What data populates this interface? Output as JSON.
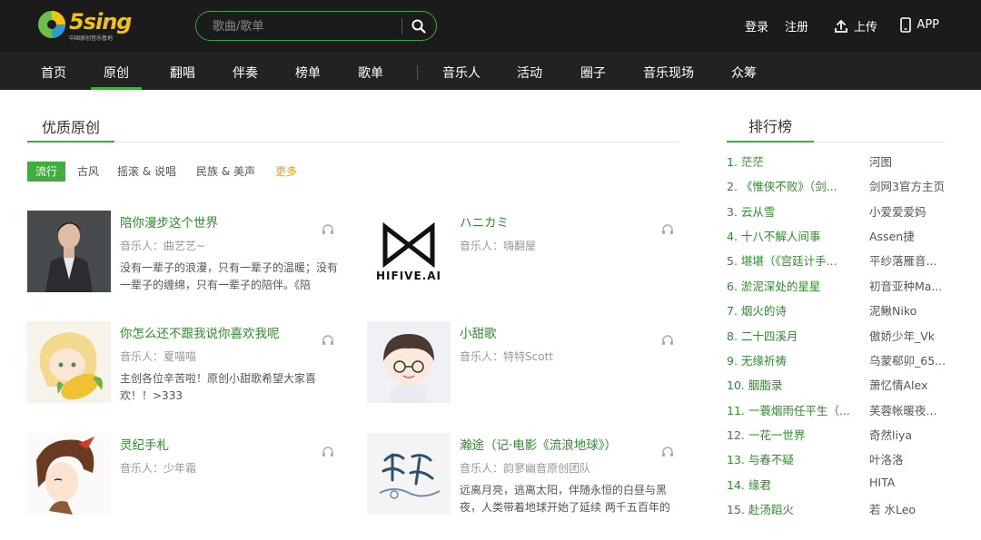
{
  "header": {
    "logo_text": "5sing",
    "logo_tagline": "中国原创音乐基地",
    "search_placeholder": "歌曲/歌单",
    "login": "登录",
    "register": "注册",
    "upload": "上传",
    "app": "APP"
  },
  "nav": {
    "items": [
      "首页",
      "原创",
      "翻唱",
      "伴奏",
      "榜单",
      "歌单",
      "音乐人",
      "活动",
      "圈子",
      "音乐现场",
      "众筹"
    ],
    "active": "原创"
  },
  "featured": {
    "title": "优质原创",
    "filters": [
      "流行",
      "古风",
      "摇滚 & 说唱",
      "民族 & 美声"
    ],
    "more": "更多",
    "songs": [
      {
        "title": "陪你漫步这个世界",
        "artist": "音乐人：曲艺艺~",
        "desc": "没有一辈子的浪漫，只有一辈子的温暖；没有一辈子的缠绵，只有一辈子的陪伴。《陪"
      },
      {
        "title": "ハニカミ",
        "artist": "音乐人：嗨翻屋",
        "desc": "",
        "cover_text": "HIFIVE.AI"
      },
      {
        "title": "你怎么还不跟我说你喜欢我呢",
        "artist": "音乐人：夏喵喵",
        "desc": "主创各位辛苦啦！原创小甜歌希望大家喜欢！！>333"
      },
      {
        "title": "小甜歌",
        "artist": "音乐人：特特Scott",
        "desc": ""
      },
      {
        "title": "灵纪手札",
        "artist": "音乐人：少年霜",
        "desc": ""
      },
      {
        "title": "瀚途（记·电影《流浪地球》）",
        "artist": "音乐人：韵寥幽音原创团队",
        "desc": "远离月亮，逃离太阳，伴随永恒的白昼与黑夜，人类带着地球开始了延续 两千五百年的"
      }
    ]
  },
  "ranking": {
    "title": "排行榜",
    "items": [
      {
        "name": "1. 茫茫",
        "artist": "河图"
      },
      {
        "name": "2. 《惟侠不败》（剑...",
        "artist": "剑网3官方主页"
      },
      {
        "name": "3. 云从雪",
        "artist": "小爱爱爱妈"
      },
      {
        "name": "4. 十八不解人间事",
        "artist": "Assen捷"
      },
      {
        "name": "5. 堪堪（《宫廷计手...",
        "artist": "平纱落雁音..."
      },
      {
        "name": "6. 淤泥深处的星星",
        "artist": "初音亚种Ma..."
      },
      {
        "name": "7. 烟火的诗",
        "artist": "泥鳅Niko"
      },
      {
        "name": "8. 二十四溪月",
        "artist": "傲娇少年_Vk"
      },
      {
        "name": "9. 无缘祈祷",
        "artist": "乌蒙郗卯_65..."
      },
      {
        "name": "10. 胭脂录",
        "artist": "萧忆情Alex"
      },
      {
        "name": "11. 一蓑烟雨任平生（...",
        "artist": "芙蓉帐暖夜..."
      },
      {
        "name": "12. 一花一世界",
        "artist": "奇然liya"
      },
      {
        "name": "13. 与春不疑",
        "artist": "叶洛洛"
      },
      {
        "name": "14. 缘君",
        "artist": "HITA"
      },
      {
        "name": "15. 赴汤蹈火",
        "artist": "若 水Leo"
      }
    ]
  },
  "colors": {
    "accent": "#3fae3f",
    "link": "#2e8b2e",
    "more": "#f39c12",
    "topbar": "#1b1b1b"
  }
}
